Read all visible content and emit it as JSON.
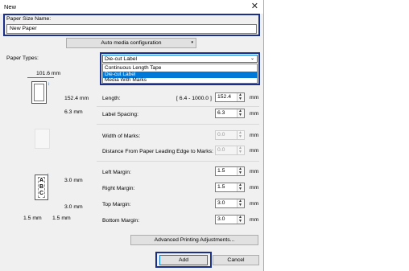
{
  "window": {
    "title": "New"
  },
  "paper_size_name": {
    "label": "Paper Size Name:",
    "value": "New Paper"
  },
  "auto_media_button": "Auto media configuration",
  "paper_types": {
    "label": "Paper Types:",
    "selected": "Die-cut Label",
    "options": [
      "Continuous Length Tape",
      "Die-cut Label",
      "Media With Marks"
    ]
  },
  "preview": {
    "width": "101.6 mm",
    "length": "152.4 mm",
    "spacing": "6.3 mm",
    "margin_top": "3.0 mm",
    "margin_bottom": "3.0 mm",
    "margin_left": "1.5 mm",
    "margin_right": "1.5 mm",
    "sample_text": "ABC"
  },
  "fields": {
    "length": {
      "label": "Length:",
      "range": "[ 6.4 - 1000.0 ]",
      "value": "152.4",
      "unit": "mm"
    },
    "label_spacing": {
      "label": "Label Spacing:",
      "value": "6.3",
      "unit": "mm"
    },
    "width_of_marks": {
      "label": "Width of Marks:",
      "value": "0.0",
      "unit": "mm"
    },
    "distance_marks": {
      "label": "Distance From Paper Leading Edge to Marks:",
      "value": "0.0",
      "unit": "mm"
    },
    "left_margin": {
      "label": "Left Margin:",
      "value": "1.5",
      "unit": "mm"
    },
    "right_margin": {
      "label": "Right Margin:",
      "value": "1.5",
      "unit": "mm"
    },
    "top_margin": {
      "label": "Top Margin:",
      "value": "3.0",
      "unit": "mm"
    },
    "bottom_margin": {
      "label": "Bottom Margin:",
      "value": "3.0",
      "unit": "mm"
    }
  },
  "advanced_button": "Advanced Printing Adjustments...",
  "add_button": "Add",
  "cancel_button": "Cancel"
}
